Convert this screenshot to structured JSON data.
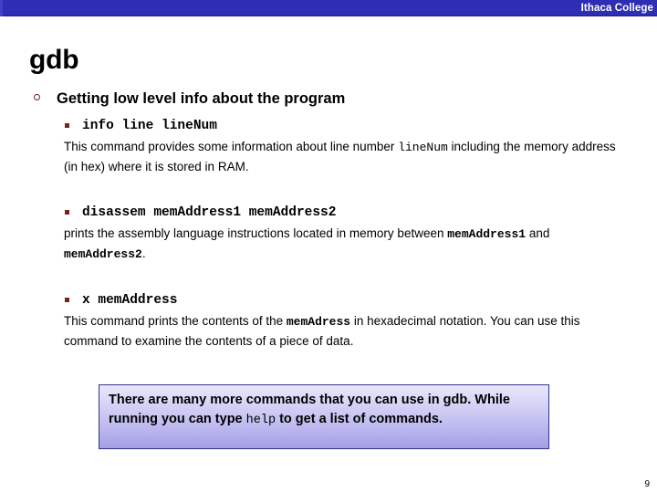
{
  "banner": {
    "institution": "Ithaca College"
  },
  "slide": {
    "title": "gdb",
    "page_number": "9"
  },
  "colors": {
    "banner_blue": "#2e2eb4",
    "bullet_maroon": "#7b1f20",
    "callout_border": "#33338c",
    "callout_gradient_top": "#e9e6fb",
    "callout_gradient_bottom": "#a3a0e6"
  },
  "bullets": {
    "level1": "Getting low level info about the program"
  },
  "sections": [
    {
      "command": "info line lineNum",
      "paragraph": {
        "part1": "This command provides some information about line number ",
        "code1": "lineNum",
        "part2": " including the memory address (in hex) where it is stored in RAM."
      }
    },
    {
      "command": "disassem memAddress1 memAddress2",
      "paragraph": {
        "part1": "prints the assembly language instructions located in memory between ",
        "code1": "memAddress1",
        "part2": " and ",
        "code2": "memAddress2",
        "part3": "."
      }
    },
    {
      "command": "x memAddress",
      "paragraph": {
        "part1": "This command prints the contents of the ",
        "code1": "memAdress",
        "part2": " in hexadecimal notation. You can use this command to examine the contents of a piece of data."
      }
    }
  ],
  "callout": {
    "part1": "There are many more commands that you can use in gdb. While running you can type ",
    "code1": "help",
    "part2": " to get a list of commands."
  }
}
